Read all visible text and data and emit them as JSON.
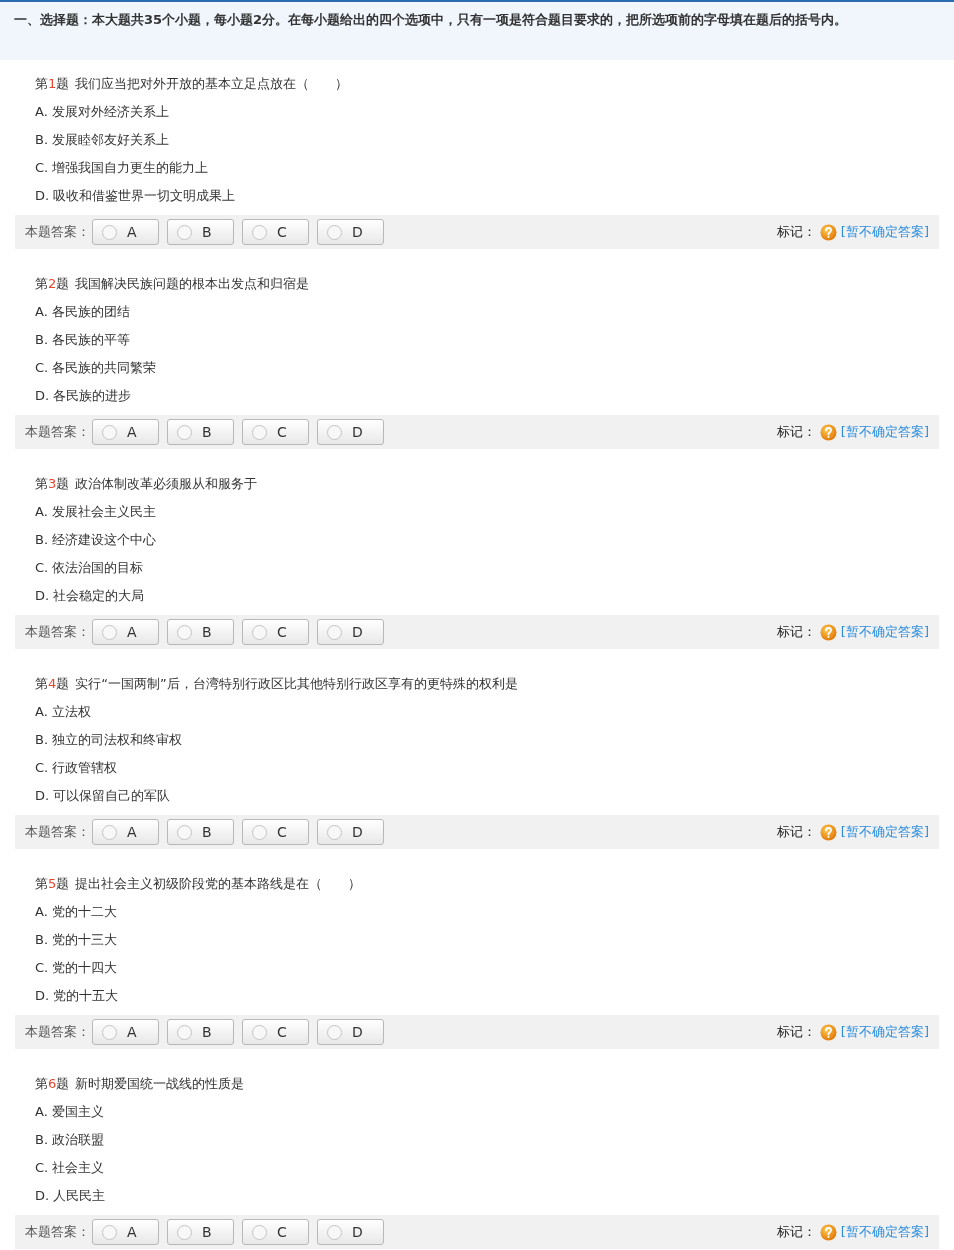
{
  "section_header": "一、选择题：本大题共35个小题，每小题2分。在每小题给出的四个选项中，只有一项是符合题目要求的，把所选项前的字母填在题后的括号内。",
  "questions": [
    {
      "prefix": "第",
      "number": "1",
      "suffix": "题",
      "text": "我们应当把对外开放的基本立足点放在（　　）",
      "options": [
        "A. 发展对外经济关系上",
        "B. 发展睦邻友好关系上",
        "C. 增强我国自力更生的能力上",
        "D. 吸收和借鉴世界一切文明成果上"
      ],
      "answer_label": "本题答案：",
      "choices": [
        {
          "label": "A",
          "selected": false
        },
        {
          "label": "B",
          "selected": false
        },
        {
          "label": "C",
          "selected": false
        },
        {
          "label": "D",
          "selected": false
        }
      ],
      "mark_label": "标记：",
      "mark_link": "[暂不确定答案]"
    },
    {
      "prefix": "第",
      "number": "2",
      "suffix": "题",
      "text": "我国解决民族问题的根本出发点和归宿是",
      "options": [
        "A. 各民族的团结",
        "B. 各民族的平等",
        "C. 各民族的共同繁荣",
        "D. 各民族的进步"
      ],
      "answer_label": "本题答案：",
      "choices": [
        {
          "label": "A",
          "selected": false
        },
        {
          "label": "B",
          "selected": false
        },
        {
          "label": "C",
          "selected": false
        },
        {
          "label": "D",
          "selected": false
        }
      ],
      "mark_label": "标记：",
      "mark_link": "[暂不确定答案]"
    },
    {
      "prefix": "第",
      "number": "3",
      "suffix": "题",
      "text": "政治体制改革必须服从和服务于",
      "options": [
        "A. 发展社会主义民主",
        "B. 经济建设这个中心",
        "C. 依法治国的目标",
        "D. 社会稳定的大局"
      ],
      "answer_label": "本题答案：",
      "choices": [
        {
          "label": "A",
          "selected": false
        },
        {
          "label": "B",
          "selected": false
        },
        {
          "label": "C",
          "selected": false
        },
        {
          "label": "D",
          "selected": false
        }
      ],
      "mark_label": "标记：",
      "mark_link": "[暂不确定答案]"
    },
    {
      "prefix": "第",
      "number": "4",
      "suffix": "题",
      "text": "实行“一国两制”后，台湾特别行政区比其他特别行政区享有的更特殊的权利是",
      "options": [
        "A. 立法权",
        "B. 独立的司法权和终审权",
        "C. 行政管辖权",
        "D. 可以保留自己的军队"
      ],
      "answer_label": "本题答案：",
      "choices": [
        {
          "label": "A",
          "selected": false
        },
        {
          "label": "B",
          "selected": false
        },
        {
          "label": "C",
          "selected": false
        },
        {
          "label": "D",
          "selected": false
        }
      ],
      "mark_label": "标记：",
      "mark_link": "[暂不确定答案]"
    },
    {
      "prefix": "第",
      "number": "5",
      "suffix": "题",
      "text": "提出社会主义初级阶段党的基本路线是在（　　）",
      "options": [
        "A. 党的十二大",
        "B. 党的十三大",
        "C. 党的十四大",
        "D. 党的十五大"
      ],
      "answer_label": "本题答案：",
      "choices": [
        {
          "label": "A",
          "selected": false
        },
        {
          "label": "B",
          "selected": false
        },
        {
          "label": "C",
          "selected": false
        },
        {
          "label": "D",
          "selected": false
        }
      ],
      "mark_label": "标记：",
      "mark_link": "[暂不确定答案]"
    },
    {
      "prefix": "第",
      "number": "6",
      "suffix": "题",
      "text": "新时期爱国统一战线的性质是",
      "options": [
        "A. 爱国主义",
        "B. 政治联盟",
        "C. 社会主义",
        "D. 人民民主"
      ],
      "answer_label": "本题答案：",
      "choices": [
        {
          "label": "A",
          "selected": false
        },
        {
          "label": "B",
          "selected": false
        },
        {
          "label": "C",
          "selected": false
        },
        {
          "label": "D",
          "selected": false
        }
      ],
      "mark_label": "标记：",
      "mark_link": "[暂不确定答案]"
    }
  ]
}
